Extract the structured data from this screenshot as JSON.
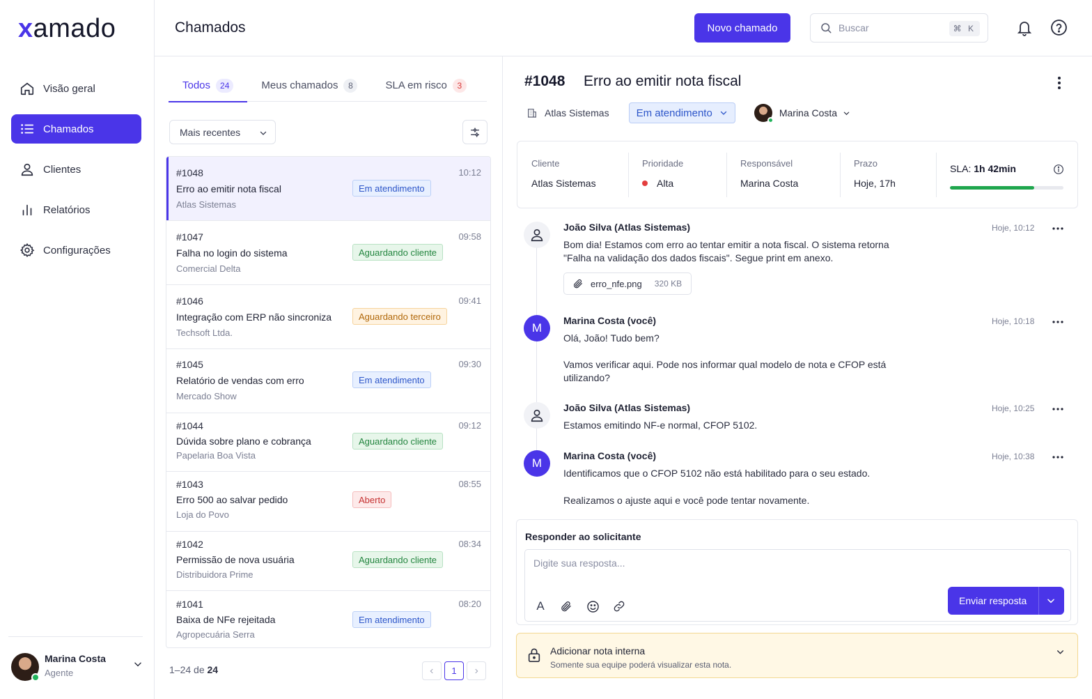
{
  "brand": {
    "logo_x": "x",
    "logo_rest": "amado",
    "accent": "#4a35e8"
  },
  "sidebar": {
    "items": [
      {
        "label": "Visão geral",
        "icon": "home-icon"
      },
      {
        "label": "Chamados",
        "icon": "list-icon",
        "active": true
      },
      {
        "label": "Clientes",
        "icon": "user-icon"
      },
      {
        "label": "Relatórios",
        "icon": "bar-chart-icon"
      },
      {
        "label": "Configurações",
        "icon": "gear-icon"
      }
    ],
    "user": {
      "name": "Marina Costa",
      "role": "Agente"
    }
  },
  "header": {
    "title": "Chamados",
    "new_button": "Novo chamado",
    "search_placeholder": "Buscar",
    "search_shortcut": "⌘ K"
  },
  "tickets_panel": {
    "tabs": [
      {
        "label": "Todos",
        "count": "24"
      },
      {
        "label": "Meus chamados",
        "count": "8"
      },
      {
        "label": "SLA em risco",
        "count": "3"
      }
    ],
    "sort_label": "Mais recentes",
    "items": [
      {
        "id": "#1048",
        "title": "Erro ao emitir nota fiscal",
        "client": "Atlas Sistemas",
        "time": "10:12",
        "status": "Em atendimento",
        "variant": "blue"
      },
      {
        "id": "#1047",
        "title": "Falha no login do sistema",
        "client": "Comercial Delta",
        "time": "09:58",
        "status": "Aguardando cliente",
        "variant": "green"
      },
      {
        "id": "#1046",
        "title": "Integração com ERP não sincroniza",
        "client": "Techsoft Ltda.",
        "time": "09:41",
        "status": "Aguardando terceiro",
        "variant": "orange"
      },
      {
        "id": "#1045",
        "title": "Relatório de vendas com erro",
        "client": "Mercado Show",
        "time": "09:30",
        "status": "Em atendimento",
        "variant": "blue"
      },
      {
        "id": "#1044",
        "title": "Dúvida sobre plano e cobrança",
        "client": "Papelaria Boa Vista",
        "time": "09:12",
        "status": "Aguardando cliente",
        "variant": "green"
      },
      {
        "id": "#1043",
        "title": "Erro 500 ao salvar pedido",
        "client": "Loja do Povo",
        "time": "08:55",
        "status": "Aberto",
        "variant": "red"
      },
      {
        "id": "#1042",
        "title": "Permissão de nova usuária",
        "client": "Distribuidora Prime",
        "time": "08:34",
        "status": "Aguardando cliente",
        "variant": "green"
      },
      {
        "id": "#1041",
        "title": "Baixa de NFe rejeitada",
        "client": "Agropecuária Serra",
        "time": "08:20",
        "status": "Em atendimento",
        "variant": "blue"
      }
    ],
    "pagination": {
      "range": "1–24",
      "of": "de",
      "total": "24",
      "current_page": "1"
    }
  },
  "ticket": {
    "id": "#1048",
    "title": "Erro ao emitir nota fiscal",
    "company": "Atlas Sistemas",
    "status": "Em atendimento",
    "assignee": "Marina Costa",
    "info": {
      "client_label": "Cliente",
      "client": "Atlas Sistemas",
      "priority_label": "Prioridade",
      "priority": "Alta",
      "owner_label": "Responsável",
      "owner": "Marina Costa",
      "deadline_label": "Prazo",
      "deadline": "Hoje, 17h",
      "sla_prefix": "SLA:",
      "sla_value": "1h 42min",
      "sla_progress": 0.74
    },
    "messages": [
      {
        "author": "João Silva (Atlas Sistemas)",
        "time": "Hoje, 10:12",
        "avatar": "person-icon",
        "lines": [
          "Bom dia! Estamos com erro ao tentar emitir a nota fiscal. O sistema retorna",
          "\"Falha na validação dos dados fiscais\". Segue print em anexo."
        ],
        "attachment": {
          "name": "erro_nfe.png",
          "size": "320 KB"
        }
      },
      {
        "author": "Marina Costa (você)",
        "time": "Hoje, 10:18",
        "avatar": "M",
        "lines": [
          "Olá, João! Tudo bem?",
          "",
          "Vamos verificar aqui. Pode nos informar qual modelo de nota e CFOP está",
          "utilizando?"
        ]
      },
      {
        "author": "João Silva (Atlas Sistemas)",
        "time": "Hoje, 10:25",
        "avatar": "person-icon",
        "lines": [
          "Estamos emitindo NF-e normal, CFOP 5102."
        ]
      },
      {
        "author": "Marina Costa (você)",
        "time": "Hoje, 10:38",
        "avatar": "M",
        "lines": [
          "Identificamos que o CFOP 5102 não está habilitado para o seu estado.",
          "",
          "Realizamos o ajuste aqui e você pode tentar novamente."
        ]
      }
    ],
    "reply": {
      "title": "Responder ao solicitante",
      "placeholder": "Digite sua resposta...",
      "format_label": "A",
      "send_label": "Enviar resposta"
    },
    "internal_note": {
      "title": "Adicionar nota interna",
      "subtitle": "Somente sua equipe poderá visualizar esta nota."
    }
  }
}
